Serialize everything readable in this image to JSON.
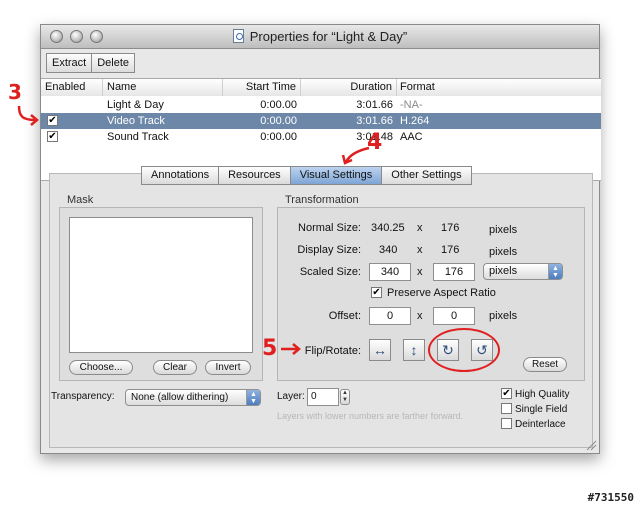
{
  "window": {
    "title": "Properties for “Light & Day”"
  },
  "toolbar": {
    "extract_label": "Extract",
    "delete_label": "Delete"
  },
  "tracks": {
    "columns": [
      "Enabled",
      "Name",
      "Start Time",
      "Duration",
      "Format"
    ],
    "rows": [
      {
        "enabled": false,
        "name": "Light & Day",
        "start": "0:00.00",
        "duration": "3:01.66",
        "format": "-NA-"
      },
      {
        "enabled": true,
        "name": "Video Track",
        "start": "0:00.00",
        "duration": "3:01.66",
        "format": "H.264",
        "selected": true
      },
      {
        "enabled": true,
        "name": "Sound Track",
        "start": "0:00.00",
        "duration": "3:01.48",
        "format": "AAC"
      }
    ]
  },
  "tabs": [
    {
      "label": "Annotations"
    },
    {
      "label": "Resources"
    },
    {
      "label": "Visual Settings",
      "active": true
    },
    {
      "label": "Other Settings"
    }
  ],
  "mask": {
    "title": "Mask",
    "choose_label": "Choose...",
    "clear_label": "Clear",
    "invert_label": "Invert"
  },
  "transformation": {
    "title": "Transformation",
    "normal_size_label": "Normal Size:",
    "normal_w": "340.25",
    "normal_h": "176",
    "display_size_label": "Display Size:",
    "display_w": "340",
    "display_h": "176",
    "scaled_size_label": "Scaled Size:",
    "scaled_w": "340",
    "scaled_h": "176",
    "units_option": "pixels",
    "times": "x",
    "pixels": "pixels",
    "preserve_label": "Preserve Aspect Ratio",
    "preserve_checked": true,
    "offset_label": "Offset:",
    "offset_x": "0",
    "offset_y": "0",
    "flip_label": "Flip/Rotate:",
    "reset_label": "Reset"
  },
  "bottom": {
    "transparency_label": "Transparency:",
    "transparency_value": "None (allow dithering)",
    "layer_label": "Layer:",
    "layer_value": "0",
    "layer_hint": "Layers with lower numbers are farther forward.",
    "high_quality_label": "High Quality",
    "high_quality_checked": true,
    "single_field_label": "Single Field",
    "deinterlace_label": "Deinterlace"
  },
  "annotations": {
    "step3": "3",
    "step4": "4",
    "step5": "5",
    "accent": "#e02020"
  },
  "watermark": "#731550",
  "colors": {
    "selection": "#6d87a8",
    "active_tab": "#7ea5d6"
  }
}
